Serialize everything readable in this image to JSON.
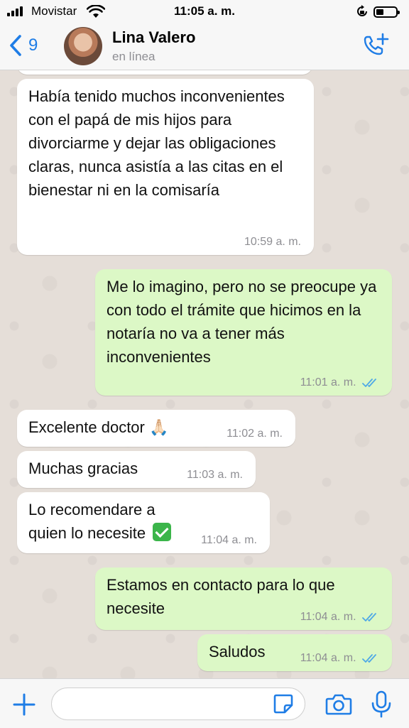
{
  "status_bar": {
    "carrier": "Movistar",
    "time": "11:05 a. m.",
    "icons": [
      "signal-icon",
      "wifi-icon",
      "orientation-lock-icon",
      "battery-icon"
    ]
  },
  "header": {
    "back_count": "9",
    "contact_name": "Lina Valero",
    "contact_status": "en línea",
    "icons": [
      "back-chevron-icon",
      "add-call-icon"
    ]
  },
  "messages": [
    {
      "direction": "in",
      "text": "Había tenido muchos inconvenientes con el papá de mis hijos para divorciarme y dejar las obligaciones claras, nunca asistía a las citas en el bienestar ni en la comisaría",
      "time": "10:59 a. m."
    },
    {
      "direction": "out",
      "text": "Me lo imagino, pero no se preocupe ya con todo el trámite que hicimos en la notaría no va a tener más inconvenientes",
      "time": "11:01 a. m.",
      "read": true
    },
    {
      "direction": "in",
      "text": "Excelente doctor",
      "emoji": "🙏🏻",
      "time": "11:02 a. m."
    },
    {
      "direction": "in",
      "text": "Muchas gracias",
      "time": "11:03 a. m."
    },
    {
      "direction": "in",
      "text": "Lo recomendare a quien lo necesite",
      "emoji": "check-mark-button-emoji",
      "time": "11:04 a. m."
    },
    {
      "direction": "out",
      "text": "Estamos en contacto para lo que necesite",
      "time": "11:04 a. m.",
      "read": true
    },
    {
      "direction": "out",
      "text": "Saludos",
      "time": "11:04 a. m.",
      "read": true
    }
  ],
  "input_bar": {
    "placeholder": "",
    "icons": [
      "plus-icon",
      "sticker-icon",
      "camera-icon",
      "microphone-icon"
    ]
  },
  "colors": {
    "incoming_bubble": "#ffffff",
    "outgoing_bubble": "#dcf8c6",
    "chat_background": "#e5ded8",
    "accent": "#1f7de6",
    "read_ticks": "#4fa9e6"
  }
}
